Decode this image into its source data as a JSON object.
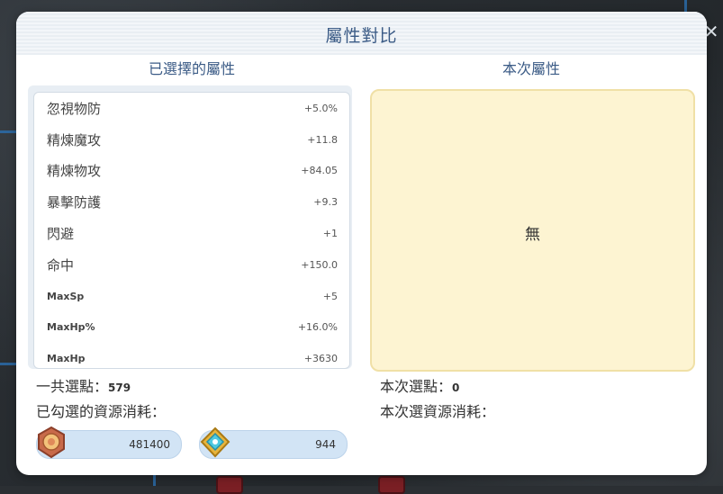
{
  "dialog": {
    "title": "屬性對比",
    "left_header": "已選擇的屬性",
    "right_header": "本次屬性",
    "close_icon": "close-icon"
  },
  "attributes": [
    {
      "name": "忽視物防",
      "value": "+5.0%"
    },
    {
      "name": "精煉魔攻",
      "value": "+11.8"
    },
    {
      "name": "精煉物攻",
      "value": "+84.05"
    },
    {
      "name": "暴擊防護",
      "value": "+9.3"
    },
    {
      "name": "閃避",
      "value": "+1"
    },
    {
      "name": "命中",
      "value": "+150.0"
    },
    {
      "name": "MaxSp",
      "value": "+5"
    },
    {
      "name": "MaxHp%",
      "value": "+16.0%"
    },
    {
      "name": "MaxHp",
      "value": "+3630"
    }
  ],
  "current": {
    "empty_text": "無"
  },
  "summary": {
    "total_points_label": "一共選點：",
    "total_points_value": "579",
    "checked_cost_label": "已勾選的資源消耗：",
    "current_points_label": "本次選點：",
    "current_points_value": "0",
    "current_cost_label": "本次選資源消耗："
  },
  "resources": [
    {
      "icon": "medal-icon",
      "amount": "481400"
    },
    {
      "icon": "crystal-badge-icon",
      "amount": "944"
    }
  ],
  "colors": {
    "title": "#3b5b86",
    "panel_right": "#fdf4d2",
    "pill": "#d2e4f5"
  }
}
